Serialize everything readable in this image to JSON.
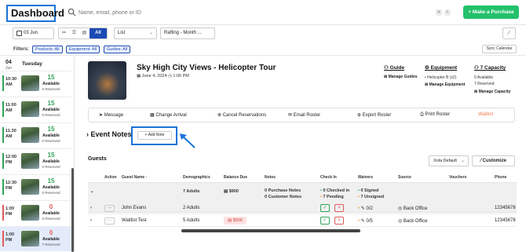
{
  "topbar": {
    "title": "Dashboard",
    "search_placeholder": "Name, email, phone or ID",
    "kbd": [
      "⌘",
      "K"
    ],
    "purchase_label": "+ Make a Purchase"
  },
  "toolbar": {
    "date": "03 Jun",
    "view_icons": [
      "≔",
      "☰",
      "▤"
    ],
    "view_all_label": "All",
    "list_label": "List",
    "tour_label": "Rafting - Month ..."
  },
  "filters": {
    "label": "Filters:",
    "chips": [
      "Products: All",
      "Equipment: All",
      "Guides: All"
    ],
    "sync_label": "Sync Calendar"
  },
  "sidebar": {
    "day_num": "04",
    "day_month": "Jun",
    "day_name": "Tuesday",
    "slots": [
      {
        "time": "10:30 AM",
        "count": "15",
        "available": "Available",
        "reserved": "0 Reserved",
        "color": "#2fa35a"
      },
      {
        "time": "11:00 AM",
        "count": "15",
        "available": "Available",
        "reserved": "0 Reserved",
        "color": "#2fa35a"
      },
      {
        "time": "11:30 AM",
        "count": "15",
        "available": "Available",
        "reserved": "0 Reserved",
        "color": "#2fa35a"
      },
      {
        "time": "12:00 PM",
        "count": "15",
        "available": "Available",
        "reserved": "0 Reserved",
        "color": "#2fa35a"
      },
      {
        "time": "12:30 PM",
        "count": "15",
        "available": "Available",
        "reserved": "0 Reserved",
        "color": "#2fa35a"
      },
      {
        "time": "1:00 PM",
        "count": "0",
        "available": "Available",
        "reserved": "0 Reserved",
        "color": "#e05b5b"
      },
      {
        "time": "1:00 PM",
        "count": "0",
        "available": "Available",
        "reserved": "7 Reserved",
        "color": "#e05b5b"
      }
    ]
  },
  "event": {
    "title": "Sky High City Views - Helicopter Tour",
    "date": "June 4, 2024",
    "time": "1:00 PM",
    "guide": {
      "heading": "Guide",
      "manage": "Manage Guides"
    },
    "equipment": {
      "heading": "Equipment",
      "item": "Helicopter B (x2)",
      "manage": "Manage Equipment"
    },
    "capacity": {
      "heading": "7 Capacity",
      "available": "0 Available",
      "reserved": "7 Reserved",
      "manage": "Manage Capacity"
    }
  },
  "actions": [
    "Message",
    "Change Arrival",
    "Cancel Reservations",
    "Email Roster",
    "Export Roster",
    "Print Roster",
    "Waitlist"
  ],
  "notes": {
    "heading": "Event Notes",
    "add_label": "+ Add Note"
  },
  "guests": {
    "heading": "Guests",
    "view_select": "Xola Default",
    "customize_label": "Customize",
    "columns": [
      "Action",
      "Guest Name ↑",
      "Demographics",
      "Balance Due",
      "Notes",
      "Check In",
      "Waivers",
      "Source",
      "Vouchers",
      "Phone"
    ],
    "summary": {
      "demographics": "7 Adults",
      "balance": "$900",
      "purchase_notes": "0 Purchase Notes",
      "customer_notes": "0 Customer Notes",
      "checked_in": "0 Checked in",
      "pending": "7 Pending",
      "signed": "0 Signed",
      "unsigned": "7 Unsigned"
    },
    "rows": [
      {
        "name": "John Evans",
        "demographics": "2 Adults",
        "balance": "",
        "waivers": "0/2",
        "source": "Back Office",
        "phone": "12345678"
      },
      {
        "name": "Waitlist Test",
        "demographics": "5 Adults",
        "balance": "$900",
        "waivers": "0/5",
        "source": "Back Office",
        "phone": "12345678"
      }
    ]
  }
}
